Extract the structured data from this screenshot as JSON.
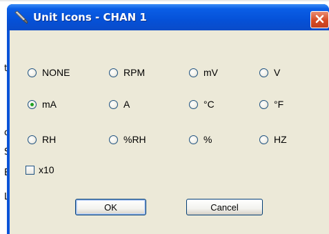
{
  "background": {
    "fragments": [
      "t",
      "o",
      "S",
      "E",
      "L"
    ]
  },
  "dialog": {
    "title": "Unit Icons - CHAN 1",
    "title_icon": "probe-icon",
    "close_icon": "close-icon",
    "units": [
      {
        "id": "none",
        "label": "NONE",
        "checked": false
      },
      {
        "id": "rpm",
        "label": "RPM",
        "checked": false
      },
      {
        "id": "mv",
        "label": "mV",
        "checked": false
      },
      {
        "id": "v",
        "label": "V",
        "checked": false
      },
      {
        "id": "ma",
        "label": "mA",
        "checked": true
      },
      {
        "id": "a",
        "label": "A",
        "checked": false
      },
      {
        "id": "c",
        "label": "°C",
        "checked": false
      },
      {
        "id": "f",
        "label": "°F",
        "checked": false
      },
      {
        "id": "rh",
        "label": "RH",
        "checked": false
      },
      {
        "id": "pct-rh",
        "label": "%RH",
        "checked": false
      },
      {
        "id": "pct",
        "label": "%",
        "checked": false
      },
      {
        "id": "hz",
        "label": "HZ",
        "checked": false
      }
    ],
    "x10": {
      "label": "x10",
      "checked": false
    },
    "ok_label": "OK",
    "cancel_label": "Cancel"
  },
  "colors": {
    "titlebar": "#0551d8",
    "client": "#ece9d8",
    "close": "#d74a23",
    "radio_dot": "#21a121"
  }
}
